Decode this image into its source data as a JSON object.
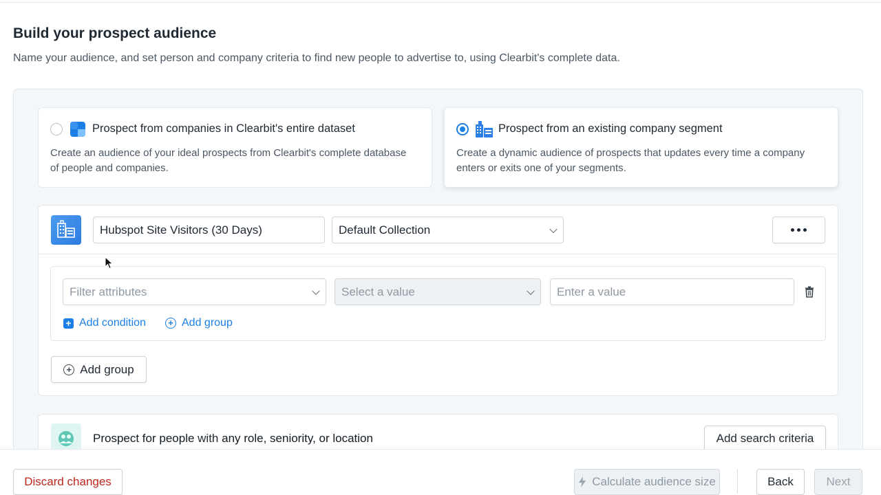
{
  "header": {
    "title": "Build your prospect audience",
    "subtitle": "Name your audience, and set person and company criteria to find new people to advertise to, using Clearbit's complete data."
  },
  "options": [
    {
      "title": "Prospect from companies in Clearbit's entire dataset",
      "description": "Create an audience of your ideal prospects from Clearbit's complete database of people and companies.",
      "selected": false,
      "icon": "dataset-icon"
    },
    {
      "title": "Prospect from an existing company segment",
      "description": "Create a dynamic audience of prospects that updates every time a company enters or exits one of your segments.",
      "selected": true,
      "icon": "building-segment-icon"
    }
  ],
  "segment": {
    "name_value": "Hubspot Site Visitors (30 Days)",
    "collection_value": "Default Collection",
    "filter": {
      "attribute_placeholder": "Filter attributes",
      "operator_placeholder": "Select a value",
      "value_placeholder": "Enter a value",
      "add_condition": "Add condition",
      "add_group": "Add group"
    },
    "add_group_button": "Add group"
  },
  "people": {
    "lead": "Prospect for people",
    "middle": " with ",
    "criteria": "any role, seniority, or location",
    "add_criteria_button": "Add search criteria"
  },
  "footer": {
    "discard": "Discard changes",
    "calculate": "Calculate audience size",
    "back": "Back",
    "next": "Next"
  },
  "colors": {
    "accent": "#1b7fe6",
    "danger": "#c0271c",
    "panel_bg": "#f3f7f9"
  }
}
